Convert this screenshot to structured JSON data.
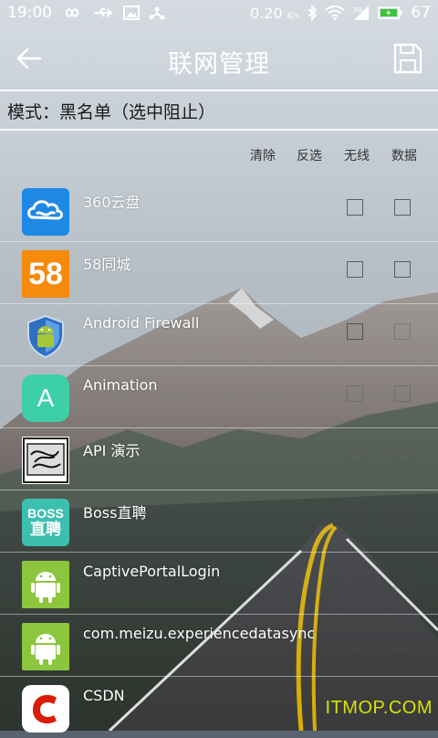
{
  "status_bar": {
    "time": "19:00",
    "net_speed": "0.20",
    "net_speed_unit": "K/s",
    "battery": "67",
    "icons": [
      "infinity-icon",
      "usb-icon",
      "image-icon",
      "share-icon",
      "bluetooth-icon",
      "wifi-icon",
      "signal-3g-icon",
      "battery-icon"
    ]
  },
  "header": {
    "title": "联网管理",
    "back_icon": "back-arrow-icon",
    "save_icon": "save-icon"
  },
  "mode_label": "模式：黑名单（选中阻止）",
  "columns": {
    "clear": "清除",
    "invert": "反选",
    "wireless": "无线",
    "data": "数据"
  },
  "apps": [
    {
      "name": "360云盘",
      "icon": "cloud-icon",
      "wifi_checked": false,
      "data_checked": false
    },
    {
      "name": "58同城",
      "icon": "58-logo-icon",
      "wifi_checked": false,
      "data_checked": false
    },
    {
      "name": "Android Firewall",
      "icon": "shield-android-icon",
      "wifi_checked": false,
      "data_checked": false
    },
    {
      "name": "Animation",
      "icon": "animation-a-icon",
      "wifi_checked": false,
      "data_checked": false
    },
    {
      "name": "API 演示",
      "icon": "api-demo-icon",
      "wifi_checked": false,
      "data_checked": false
    },
    {
      "name": "Boss直聘",
      "icon": "boss-logo-icon",
      "wifi_checked": false,
      "data_checked": false
    },
    {
      "name": "CaptivePortalLogin",
      "icon": "android-robot-icon",
      "wifi_checked": false,
      "data_checked": false
    },
    {
      "name": "com.meizu.experiencedatasync",
      "icon": "android-robot-icon",
      "wifi_checked": false,
      "data_checked": false
    },
    {
      "name": "CSDN",
      "icon": "csdn-logo-icon",
      "wifi_checked": false,
      "data_checked": false
    }
  ],
  "icon_texts": {
    "boss_line1": "BOSS",
    "boss_line2": "直聘",
    "num58": "58",
    "anim_letter": "A"
  },
  "watermark": "ITMOP.COM",
  "colors": {
    "accent_orange": "#f58a0b",
    "android_green": "#8cc63f",
    "boss_teal": "#3dbfb0",
    "csdn_red": "#d81e06",
    "cloud_blue": "#1e88e5"
  }
}
